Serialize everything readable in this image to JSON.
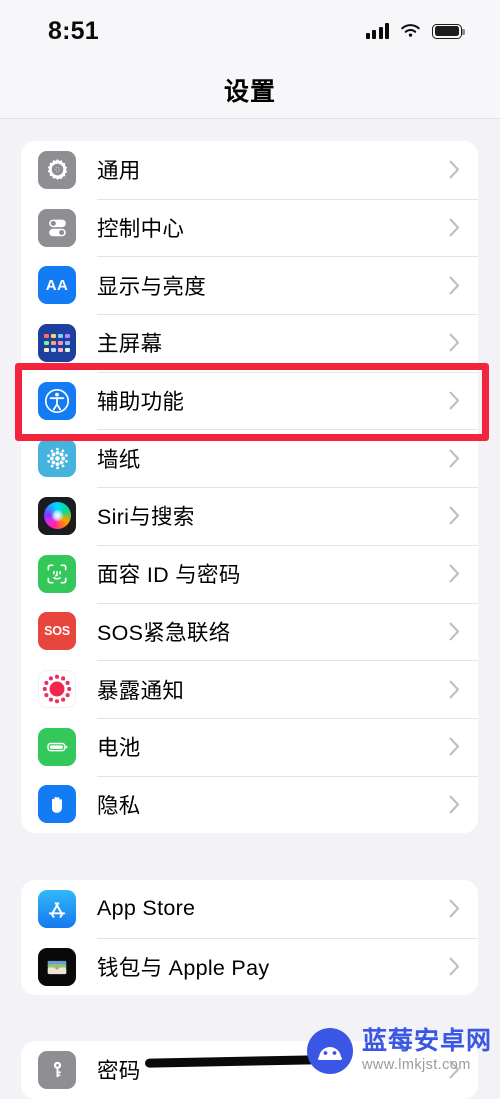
{
  "status_bar": {
    "time": "8:51",
    "signal_icon": "cellular-signal-icon",
    "signal_bars": 4,
    "wifi_icon": "wifi-icon",
    "battery_icon": "battery-full-icon"
  },
  "header": {
    "title": "设置"
  },
  "groups": [
    {
      "id": "group-system",
      "rows": [
        {
          "label": "通用",
          "icon": "gear-icon",
          "icon_class": "ic-gear",
          "color": "#8e8e93",
          "highlighted": false
        },
        {
          "label": "控制中心",
          "icon": "control-center-icon",
          "icon_class": "ic-cc",
          "color": "#8e8e93",
          "highlighted": false
        },
        {
          "label": "显示与亮度",
          "icon": "display-brightness-icon",
          "icon_class": "ic-aa",
          "color": "#137bf4",
          "highlighted": false
        },
        {
          "label": "主屏幕",
          "icon": "home-screen-icon",
          "icon_class": "ic-home",
          "color": "#1d3f9e",
          "highlighted": false
        },
        {
          "label": "辅助功能",
          "icon": "accessibility-icon",
          "icon_class": "ic-acc",
          "color": "#137bf4",
          "highlighted": true
        },
        {
          "label": "墙纸",
          "icon": "wallpaper-icon",
          "icon_class": "ic-wall",
          "color": "#45b3dd",
          "highlighted": false
        },
        {
          "label": "Siri与搜索",
          "icon": "siri-icon",
          "icon_class": "ic-siri",
          "color": "#1b1b22",
          "highlighted": false
        },
        {
          "label": "面容 ID 与密码",
          "icon": "face-id-icon",
          "icon_class": "ic-face",
          "color": "#34c759",
          "highlighted": false
        },
        {
          "label": "SOS紧急联络",
          "icon": "sos-icon",
          "icon_class": "ic-sos",
          "color": "#e8453c",
          "highlighted": false
        },
        {
          "label": "暴露通知",
          "icon": "exposure-notification-icon",
          "icon_class": "ic-expo",
          "color": "#f2264b",
          "highlighted": false
        },
        {
          "label": "电池",
          "icon": "battery-icon",
          "icon_class": "ic-batt",
          "color": "#34c759",
          "highlighted": false
        },
        {
          "label": "隐私",
          "icon": "privacy-hand-icon",
          "icon_class": "ic-priv",
          "color": "#137bf4",
          "highlighted": false
        }
      ]
    },
    {
      "id": "group-store",
      "rows": [
        {
          "label": "App Store",
          "icon": "app-store-icon",
          "icon_class": "ic-appstore",
          "color": "#1479f0",
          "highlighted": false
        },
        {
          "label": "钱包与 Apple Pay",
          "icon": "wallet-icon",
          "icon_class": "ic-wallet",
          "color": "#0a0a0a",
          "highlighted": false
        }
      ]
    },
    {
      "id": "group-passwords",
      "rows": [
        {
          "label": "密码",
          "icon": "key-icon",
          "icon_class": "ic-pass",
          "color": "#8e8e93",
          "highlighted": false
        }
      ]
    }
  ],
  "icon_labels": {
    "aa": "AA",
    "sos": "SOS"
  },
  "highlight": {
    "target_label": "辅助功能",
    "color": "#f4243c"
  },
  "watermark": {
    "site_name": "蓝莓安卓网",
    "url": "www.lmkjst.com",
    "logo": "android-robot-icon",
    "brand_color": "#3a56e4"
  },
  "home_indicator": "home-indicator-bar"
}
